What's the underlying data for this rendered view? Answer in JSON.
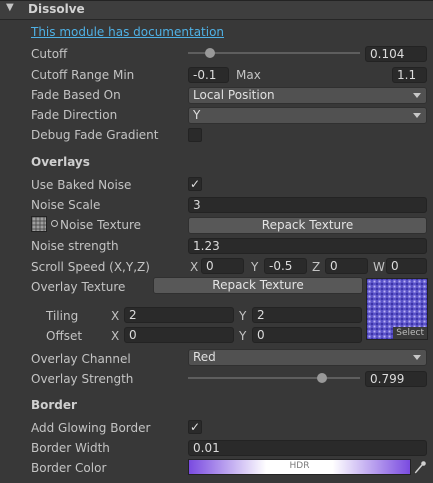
{
  "module": {
    "title": "Dissolve",
    "collapse_arrow": "triangle-down-icon",
    "doc_link": "This module has documentation"
  },
  "cutoff": {
    "label": "Cutoff",
    "value": "0.104",
    "slider_fraction": 0.104
  },
  "cutoff_range": {
    "label": "Cutoff Range Min",
    "min": "-0.1",
    "max_label": "Max",
    "max": "1.1"
  },
  "fade_based_on": {
    "label": "Fade Based On",
    "value": "Local Position"
  },
  "fade_direction": {
    "label": "Fade Direction",
    "value": "Y"
  },
  "debug_fade": {
    "label": "Debug Fade Gradient",
    "checked": false
  },
  "overlays": {
    "heading": "Overlays",
    "use_baked_noise": {
      "label": "Use Baked Noise",
      "checked": true,
      "check_glyph": "✓"
    },
    "noise_scale": {
      "label": "Noise Scale",
      "value": "3"
    },
    "noise_texture": {
      "label": "Noise Texture",
      "button": "Repack Texture",
      "thumb_icon": "noise-texture-thumbnail-icon",
      "picker_icon": "object-picker-icon"
    },
    "noise_strength": {
      "label": "Noise strength",
      "value": "1.23"
    },
    "scroll_speed": {
      "label": "Scroll Speed (X,Y,Z)",
      "x_label": "X",
      "x": "0",
      "y_label": "Y",
      "y": "-0.5",
      "z_label": "Z",
      "z": "0",
      "w_label": "W",
      "w": "0"
    },
    "overlay_texture": {
      "label": "Overlay Texture",
      "button": "Repack Texture",
      "select_label": "Select"
    },
    "tiling": {
      "label": "Tiling",
      "x_label": "X",
      "x": "2",
      "y_label": "Y",
      "y": "2"
    },
    "offset": {
      "label": "Offset",
      "x_label": "X",
      "x": "0",
      "y_label": "Y",
      "y": "0"
    },
    "overlay_channel": {
      "label": "Overlay Channel",
      "value": "Red"
    },
    "overlay_strength": {
      "label": "Overlay Strength",
      "value": "0.799",
      "slider_fraction": 0.799
    }
  },
  "border": {
    "heading": "Border",
    "add_glowing_border": {
      "label": "Add Glowing Border",
      "checked": true,
      "check_glyph": "✓"
    },
    "border_width": {
      "label": "Border Width",
      "value": "0.01"
    },
    "border_color": {
      "label": "Border Color",
      "hdr_label": "HDR",
      "picker_icon": "eyedropper-icon"
    }
  },
  "colors": {
    "background": "#383838",
    "link": "#4fb1e5",
    "border_gradient_start": "#7a4be0",
    "border_gradient_mid": "#ffffff",
    "texture_tint": "#6a5acd"
  }
}
